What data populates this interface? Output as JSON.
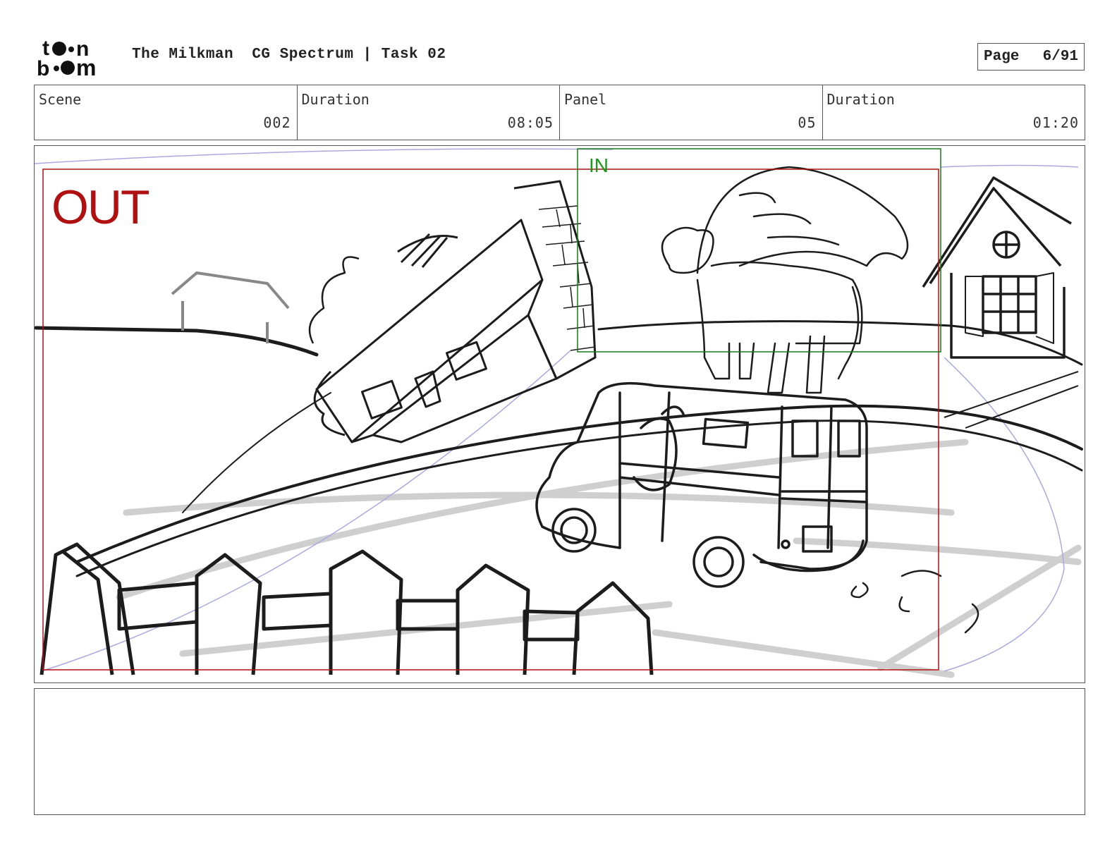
{
  "header": {
    "logo_text": "toon boom",
    "title": "The Milkman  CG Spectrum | Task 02",
    "page_label": "Page",
    "page_value": "6/91"
  },
  "info": [
    {
      "label": "Scene",
      "value": "002"
    },
    {
      "label": "Duration",
      "value": "08:05"
    },
    {
      "label": "Panel",
      "value": "05"
    },
    {
      "label": "Duration",
      "value": "01:20"
    }
  ],
  "panel": {
    "out_label": "OUT",
    "in_label": "IN",
    "colors": {
      "out_frame": "#b01010",
      "in_frame": "#1a7a1a",
      "sketch": "#1c1c1c",
      "guide": "#9a9ad8"
    }
  },
  "notes": {
    "text": ""
  }
}
